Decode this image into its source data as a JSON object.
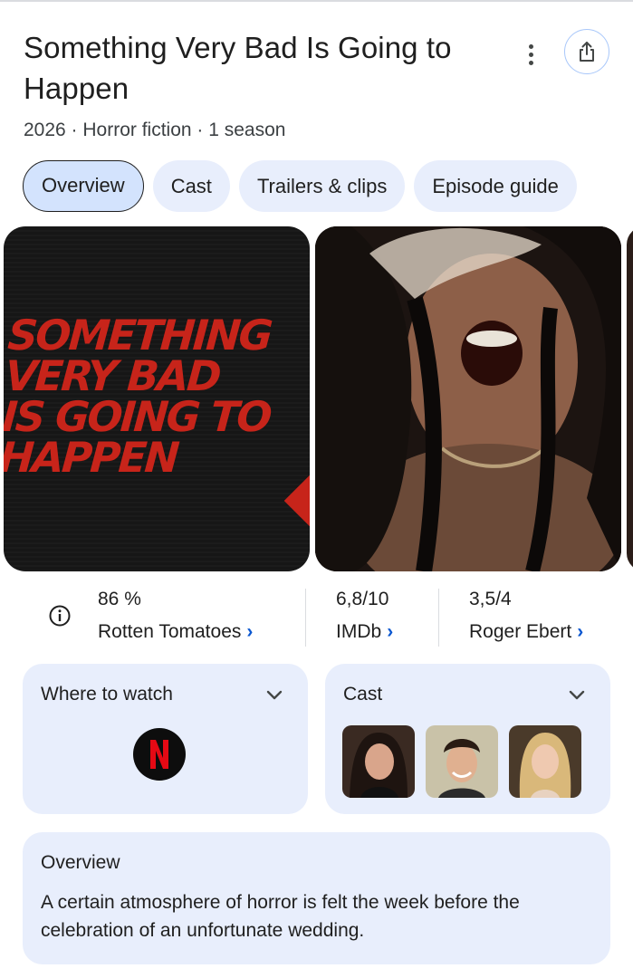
{
  "header": {
    "title": "Something Very Bad Is Going to Happen",
    "subtitle": "2026 · Horror fiction · 1 season"
  },
  "tabs": [
    {
      "label": "Overview",
      "active": true
    },
    {
      "label": "Cast",
      "active": false
    },
    {
      "label": "Trailers & clips",
      "active": false
    },
    {
      "label": "Episode guide",
      "active": false
    }
  ],
  "media": {
    "poster_text": "SOMETHING\nVERY BAD\nIS GOING TO\nHAPPEN"
  },
  "ratings": [
    {
      "score": "86 %",
      "source": "Rotten Tomatoes",
      "chevron": "›"
    },
    {
      "score": "6,8/10",
      "source": "IMDb",
      "chevron": "›"
    },
    {
      "score": "3,5/4",
      "source": "Roger Ebert",
      "chevron": "›"
    }
  ],
  "where_to_watch": {
    "title": "Where to watch",
    "provider_logo_letter": "N",
    "provider_color": "#e50914"
  },
  "cast_card": {
    "title": "Cast"
  },
  "overview": {
    "title": "Overview",
    "text": "A certain atmosphere of horror is felt the week before the celebration of an unfortunate wedding."
  },
  "colors": {
    "chip_bg": "#e8eefc",
    "chip_active_bg": "#d3e3fd",
    "link_blue": "#0b57d0",
    "poster_red": "#c7241a"
  },
  "icons": [
    "more-vert-icon",
    "share-icon",
    "info-icon",
    "chevron-down-icon"
  ]
}
